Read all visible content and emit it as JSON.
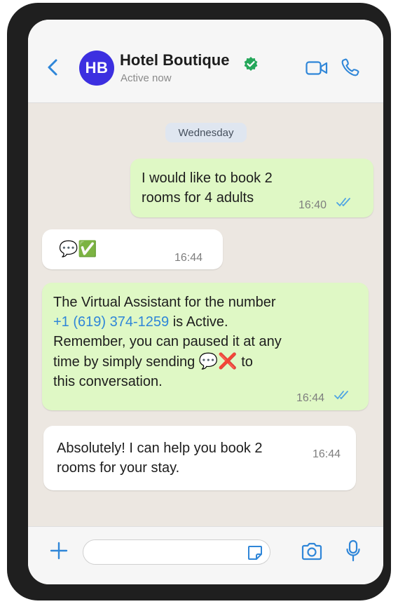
{
  "header": {
    "avatar_initials": "HB",
    "contact_name": "Hotel Boutique",
    "status": "Active now",
    "accent_color": "#2f86d8",
    "avatar_color": "#3c2fe0",
    "verified_color": "#25a75a",
    "icons": [
      "back-arrow-icon",
      "verified-badge-icon",
      "video-call-icon",
      "phone-call-icon"
    ]
  },
  "chat": {
    "day_label": "Wednesday",
    "messages": [
      {
        "direction": "outgoing",
        "text": "I would like to book 2\nrooms for 4 adults",
        "time": "16:40",
        "status": "read"
      },
      {
        "direction": "incoming",
        "text": "💬✅",
        "time": "16:44"
      },
      {
        "direction": "outgoing",
        "text_before": "The Virtual Assistant for the number",
        "phone": "+1 (619) 374-1259",
        "text_after": " is Active.\nRemember, you can paused it at any\ntime by simply sending ",
        "emoji": "💬❌",
        "text_end": "  to\nthis conversation.",
        "time": "16:44",
        "status": "read"
      },
      {
        "direction": "incoming",
        "text": "Absolutely! I can help you book 2\nrooms for your stay.",
        "time": "16:44"
      }
    ],
    "background_color": "#ece7e1",
    "outgoing_color": "#dff8c5"
  },
  "composer": {
    "input_value": "",
    "icons": [
      "plus-icon",
      "sticker-icon",
      "camera-icon",
      "microphone-icon"
    ]
  }
}
